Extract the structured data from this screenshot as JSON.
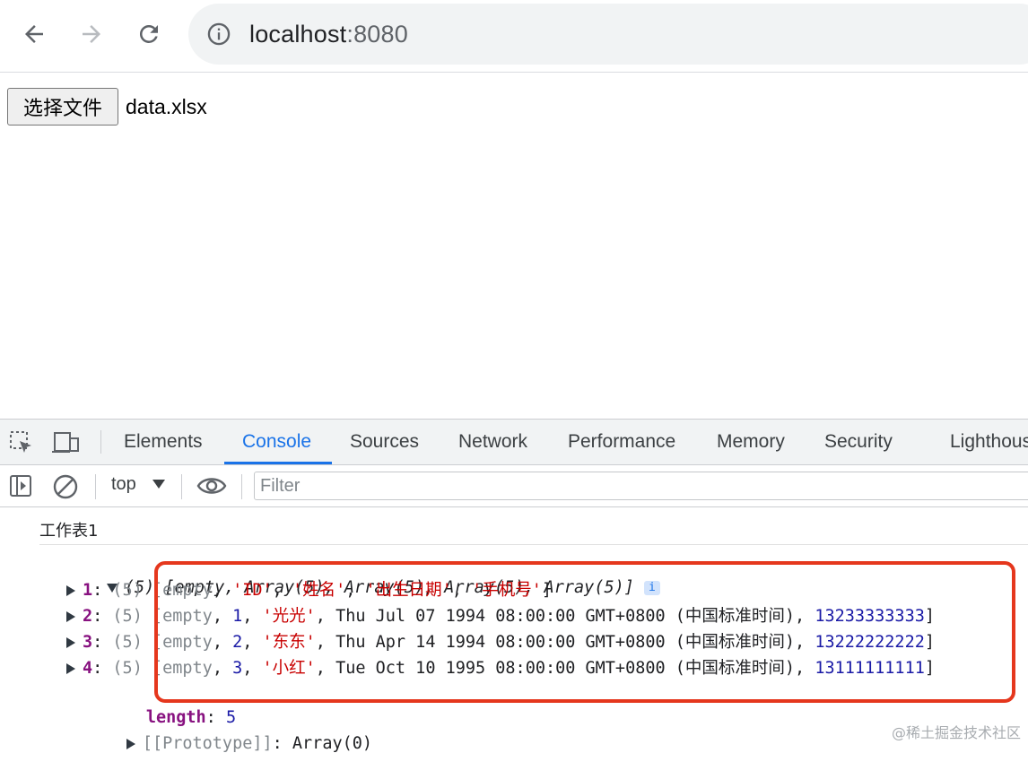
{
  "browser": {
    "url_host": "localhost",
    "url_port": ":8080",
    "icons": {
      "back": "arrow-left-icon",
      "forward": "arrow-right-icon",
      "reload": "reload-icon",
      "info": "info-circle-icon"
    }
  },
  "page": {
    "file_button_label": "选择文件",
    "file_name": "data.xlsx"
  },
  "devtools": {
    "tabs": [
      "Elements",
      "Console",
      "Sources",
      "Network",
      "Performance",
      "Memory",
      "Security",
      "Lighthouse"
    ],
    "active_tab": "Console",
    "context": "top",
    "filter_placeholder": "Filter",
    "log_label": "工作表1",
    "array_summary": {
      "count": "(5)",
      "preview": "[empty, Array(5), Array(5), Array(5), Array(5)]",
      "badge": "i"
    },
    "rows": [
      {
        "index": "1",
        "count": "(5)",
        "parts": [
          [
            "g",
            "[empty"
          ],
          [
            "d",
            ", "
          ],
          [
            "s",
            "'ID'"
          ],
          [
            "d",
            ", "
          ],
          [
            "s",
            "'姓名'"
          ],
          [
            "d",
            ", "
          ],
          [
            "s",
            "'出生日期'"
          ],
          [
            "d",
            ", "
          ],
          [
            "s",
            "'手机号'"
          ],
          [
            "d",
            "]"
          ]
        ]
      },
      {
        "index": "2",
        "count": "(5)",
        "parts": [
          [
            "g",
            "[empty"
          ],
          [
            "d",
            ", "
          ],
          [
            "n",
            "1"
          ],
          [
            "d",
            ", "
          ],
          [
            "s",
            "'光光'"
          ],
          [
            "d",
            ", Thu Jul 07 1994 08:00:00 GMT+0800 (中国标准时间), "
          ],
          [
            "n",
            "13233333333"
          ],
          [
            "d",
            "]"
          ]
        ]
      },
      {
        "index": "3",
        "count": "(5)",
        "parts": [
          [
            "g",
            "[empty"
          ],
          [
            "d",
            ", "
          ],
          [
            "n",
            "2"
          ],
          [
            "d",
            ", "
          ],
          [
            "s",
            "'东东'"
          ],
          [
            "d",
            ", Thu Apr 14 1994 08:00:00 GMT+0800 (中国标准时间), "
          ],
          [
            "n",
            "13222222222"
          ],
          [
            "d",
            "]"
          ]
        ]
      },
      {
        "index": "4",
        "count": "(5)",
        "parts": [
          [
            "g",
            "[empty"
          ],
          [
            "d",
            ", "
          ],
          [
            "n",
            "3"
          ],
          [
            "d",
            ", "
          ],
          [
            "s",
            "'小红'"
          ],
          [
            "d",
            ", Tue Oct 10 1995 08:00:00 GMT+0800 (中国标准时间), "
          ],
          [
            "n",
            "13111111111"
          ],
          [
            "d",
            "]"
          ]
        ]
      }
    ],
    "length_key": "length",
    "length_value": "5",
    "prototype_key": "[[Prototype]]",
    "prototype_value": "Array(0)"
  },
  "watermark": "@稀土掘金技术社区",
  "colors": {
    "accent": "#1a73e8",
    "highlight": "#e5371d",
    "string": "#c80000",
    "number": "#1a1aa6",
    "key": "#881280"
  }
}
